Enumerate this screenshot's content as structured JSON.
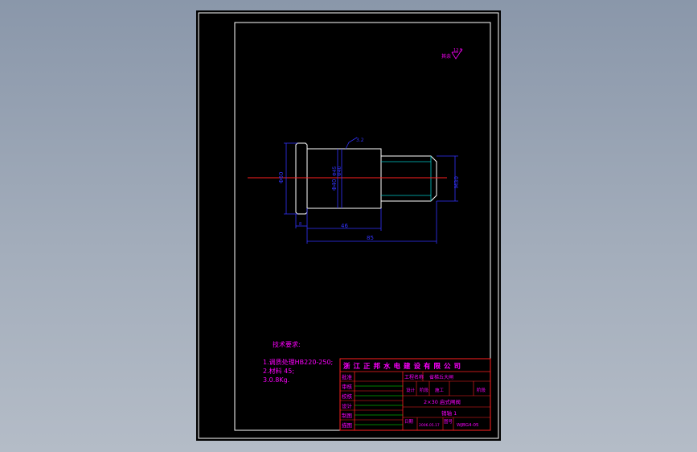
{
  "colors": {
    "background": "#96a2b3",
    "sheet": "#000000",
    "outline": "#ffffff",
    "dimension": "#3333ff",
    "centerline": "#ff0000",
    "thread": "#00c8c8",
    "notes": "#ff00ff",
    "title_block": "#ff0000",
    "table_lines": "#00ff00"
  },
  "roughness": {
    "label": "其余",
    "value": "12.5"
  },
  "dimensions": {
    "head_dia": "Φ60",
    "body_dia_1": "Φ40",
    "body_dia_2": "Φ45",
    "shoulder_dia": "Φ40",
    "thread": "M30",
    "surface_mark": "3.2",
    "len_body": "46",
    "len_total": "85",
    "len_head": "8"
  },
  "notes": {
    "title": "技术要求:",
    "items": [
      "1.调质处理HB220-250;",
      "2.材料 45;",
      "3.0.8Kg."
    ]
  },
  "title_block": {
    "company": "浙江正邦水电建设有限公司",
    "project_label": "工程名称",
    "project_value": "省梯丘大闸",
    "row_labels": [
      "批准",
      "审核",
      "校核",
      "设计",
      "制图",
      "描图"
    ],
    "stage_labels": [
      "设计",
      "阶段",
      "施工",
      "阶段"
    ],
    "drawing_name": "2×30 启式闸阀",
    "part_name": "销轴 1",
    "date_label": "日期",
    "date_value": "2006.05.17",
    "number_label": "图号",
    "number_value": "WJBG4-05"
  }
}
